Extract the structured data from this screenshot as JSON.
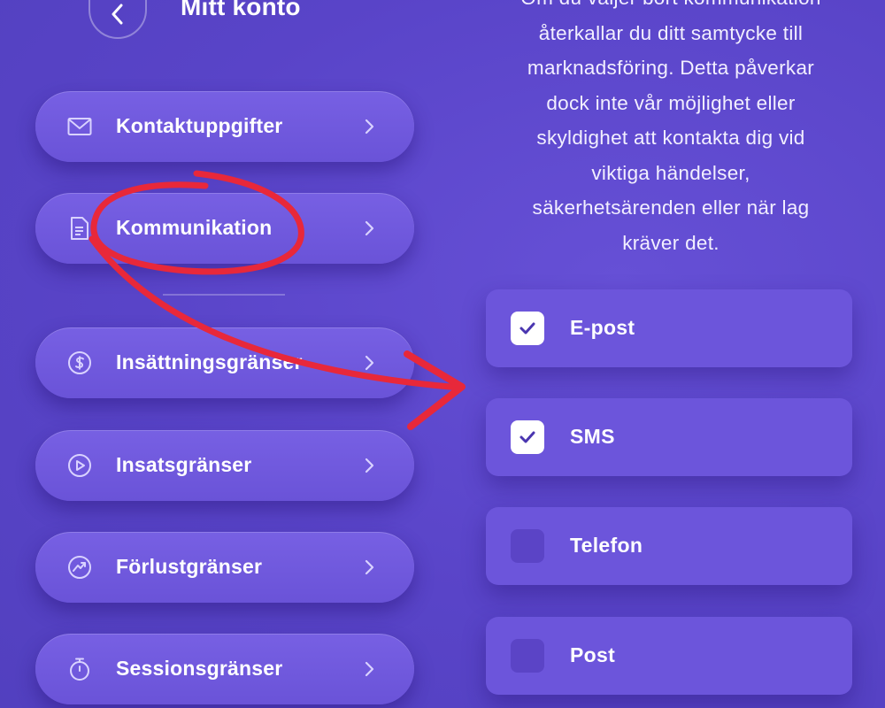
{
  "header": {
    "title": "Mitt konto"
  },
  "menu": {
    "items": [
      {
        "label": "Kontaktuppgifter",
        "icon": "mail-icon"
      },
      {
        "label": "Kommunikation",
        "icon": "document-icon"
      },
      {
        "label": "Insättningsgränser",
        "icon": "dollar-icon"
      },
      {
        "label": "Insatsgränser",
        "icon": "play-icon"
      },
      {
        "label": "Förlustgränser",
        "icon": "chart-icon"
      },
      {
        "label": "Sessionsgränser",
        "icon": "stopwatch-icon"
      }
    ]
  },
  "description": {
    "lines": [
      "Om du väljer bort kommunikation",
      "återkallar du ditt samtycke till",
      "marknadsföring. Detta påverkar",
      "dock inte vår möjlighet eller",
      "skyldighet att kontakta dig vid",
      "viktiga händelser,",
      "säkerhetsärenden eller när lag",
      "kräver det."
    ]
  },
  "options": [
    {
      "label": "E-post",
      "checked": true
    },
    {
      "label": "SMS",
      "checked": true
    },
    {
      "label": "Telefon",
      "checked": false
    },
    {
      "label": "Post",
      "checked": false
    }
  ],
  "colors": {
    "background": "#5a43c9",
    "card": "#6c55db",
    "annotation": "#e8283a"
  }
}
